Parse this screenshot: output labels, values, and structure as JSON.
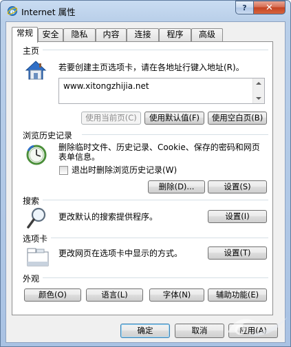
{
  "window": {
    "title": "Internet 属性"
  },
  "tabs": [
    {
      "label": "常规",
      "active": true
    },
    {
      "label": "安全"
    },
    {
      "label": "隐私"
    },
    {
      "label": "内容"
    },
    {
      "label": "连接"
    },
    {
      "label": "程序"
    },
    {
      "label": "高级"
    }
  ],
  "home": {
    "title": "主页",
    "desc": "若要创建主页选项卡，请在各地址行键入地址(R)。",
    "url": "www.xitongzhijia.net",
    "btn_current": "使用当前页(C)",
    "btn_default": "使用默认值(F)",
    "btn_blank": "使用空白页(B)"
  },
  "history": {
    "title": "浏览历史记录",
    "desc_line1": "删除临时文件、历史记录、Cookie、保存的密码和网页",
    "desc_line2": "表单信息。",
    "checkbox_label": "退出时删除浏览历史记录(W)",
    "checkbox_checked": false,
    "btn_delete": "删除(D)...",
    "btn_settings": "设置(S)"
  },
  "search": {
    "title": "搜索",
    "desc": "更改默认的搜索提供程序。",
    "btn_settings": "设置(I)"
  },
  "tabs_section": {
    "title": "选项卡",
    "desc": "更改网页在选项卡中显示的方式。",
    "btn_settings": "设置(T)"
  },
  "appearance": {
    "title": "外观",
    "btn_colors": "颜色(O)",
    "btn_languages": "语言(L)",
    "btn_fonts": "字体(N)",
    "btn_accessibility": "辅助功能(E)"
  },
  "footer": {
    "btn_ok": "确定",
    "btn_cancel": "取消",
    "btn_apply": "应用(A)"
  },
  "icons": {
    "app": "ie-globe-icon",
    "home": "house-icon",
    "history": "clock-icon",
    "search": "magnifier-icon",
    "tabs": "tabbed-window-icon"
  },
  "colors": {
    "accent": "#3c7fb1",
    "frame": "#b9cfe9",
    "close": "#c44424"
  }
}
